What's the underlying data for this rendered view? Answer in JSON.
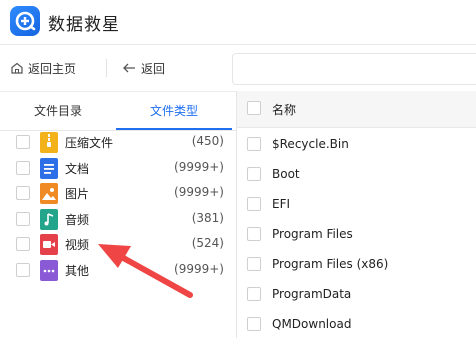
{
  "app": {
    "title": "数据救星",
    "logo_icon": "recovery-plus-icon",
    "accent": "#1f6ff0"
  },
  "nav": {
    "home_label": "返回主页",
    "back_label": "返回"
  },
  "tabs": [
    {
      "label": "文件目录",
      "active": false
    },
    {
      "label": "文件类型",
      "active": true
    }
  ],
  "categories": [
    {
      "label": "压缩文件",
      "count": "(450)",
      "icon": "archive-icon",
      "color": "#f3b21a"
    },
    {
      "label": "文档",
      "count": "(9999+)",
      "icon": "document-icon",
      "color": "#2d6fe6"
    },
    {
      "label": "图片",
      "count": "(9999+)",
      "icon": "image-icon",
      "color": "#f08a24"
    },
    {
      "label": "音频",
      "count": "(381)",
      "icon": "music-icon",
      "color": "#22a58a"
    },
    {
      "label": "视频",
      "count": "(524)",
      "icon": "video-icon",
      "color": "#e5414b"
    },
    {
      "label": "其他",
      "count": "(9999+)",
      "icon": "more-icon",
      "color": "#8a5ad6"
    }
  ],
  "files": {
    "header": "名称",
    "rows": [
      "$Recycle.Bin",
      "Boot",
      "EFI",
      "Program Files",
      "Program Files (x86)",
      "ProgramData",
      "QMDownload"
    ]
  },
  "annotation": {
    "arrow_color": "#ef4545",
    "target": "视频"
  }
}
